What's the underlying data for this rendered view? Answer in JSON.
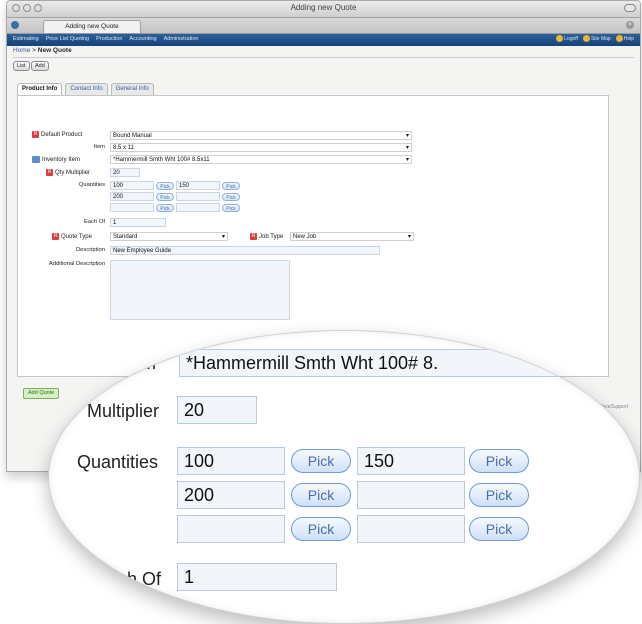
{
  "window": {
    "title": "Adding new Quote",
    "tab_label": "Adding new Quote"
  },
  "nav": {
    "items": [
      "Estimating",
      "Price List Quoting",
      "Production",
      "Accounting",
      "Administration"
    ],
    "right": [
      "Logoff",
      "Site Map",
      "Help"
    ]
  },
  "breadcrumb": {
    "home": "Home",
    "sep": " > ",
    "current": "New Quote"
  },
  "buttons": {
    "list": "List",
    "add": "Add",
    "add_quote": "Add Quote"
  },
  "tabs": [
    "Product Info",
    "Contact Info",
    "General Info"
  ],
  "form": {
    "default_product": {
      "label": "Default Product",
      "value": "Bound Manual"
    },
    "item": {
      "label": "Item",
      "value": "8.5 x 11"
    },
    "inventory_item": {
      "label": "Inventory Item",
      "value": "*Hammermill Smth Wht 100# 8.5x11"
    },
    "qty_multiplier": {
      "label": "Qty Multiplier",
      "value": "20"
    },
    "quantities": {
      "label": "Quantities",
      "values": [
        "100",
        "150",
        "200",
        "",
        "",
        ""
      ],
      "pick_label": "Pick"
    },
    "each_of": {
      "label": "Each Of",
      "value": "1"
    },
    "quote_type": {
      "label": "Quote Type",
      "value": "Standard"
    },
    "job_type": {
      "label": "Job Type",
      "value": "New Job"
    },
    "description": {
      "label": "Description",
      "value": "New Employee Guide"
    },
    "additional_description": {
      "label": "Additional Description",
      "value": ""
    }
  },
  "footer_link": "Built on PaceSupport",
  "magnifier": {
    "item_partial": "m",
    "inventory_partial": "*Hammermill Smth Wht 100# 8.",
    "multiplier_label": "Multiplier",
    "multiplier_value": "20",
    "quantities_label": "Quantities",
    "q1": "100",
    "q2": "150",
    "q3": "200",
    "pick": "Pick",
    "eachof_label": "h Of",
    "eachof_value": "1"
  }
}
